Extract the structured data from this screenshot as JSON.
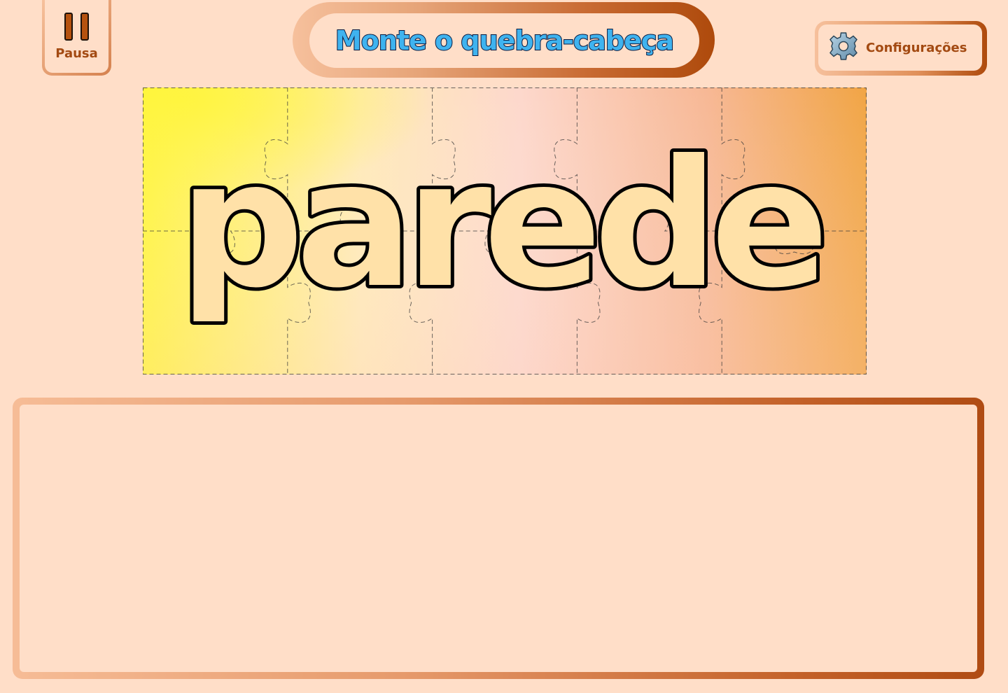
{
  "pause_button": {
    "label": "Pausa",
    "icon": "pause-icon"
  },
  "title": {
    "text": "Monte o quebra-cabeça"
  },
  "settings_button": {
    "label": "Configurações",
    "icon": "gear-icon"
  },
  "puzzle": {
    "word": "parede",
    "grid": {
      "columns": 5,
      "rows": 2
    },
    "gradient_colors": [
      "#fff53c",
      "#ffeab8",
      "#fdd8cc",
      "#f7b895",
      "#f1a545"
    ],
    "letter_fill": "#ffe1a8",
    "letter_outline": "#000000"
  },
  "pieces_tray": {
    "items": []
  },
  "colors": {
    "background": "#ffdec8",
    "accent_dark": "#ae4a0c",
    "accent_light": "#f6c09c",
    "title_fill": "#3fb3ef",
    "title_outline": "#0a1a40"
  }
}
